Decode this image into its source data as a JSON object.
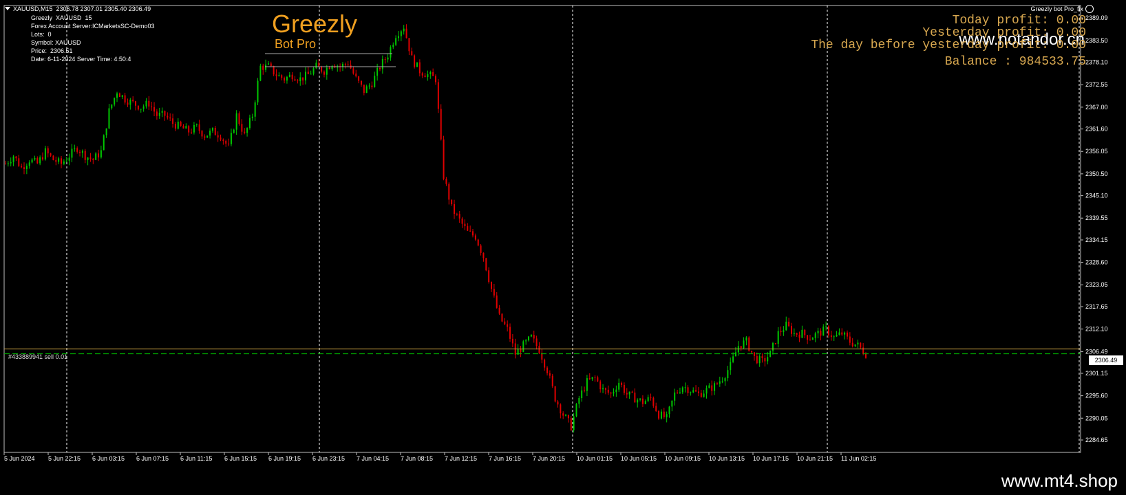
{
  "header": {
    "symbol_line": "XAUUSD,M15  2306.78 2307.01 2305.40 2306.49",
    "info_lines": [
      "Greezly  XAUUSD  15",
      "Forex Account Server:ICMarketsSC-Demo03",
      "Lots:  0",
      "Symbol: XAUUSD",
      "Price:  2306.51",
      "Date: 6-11-2024 Server Time: 4:50:4"
    ],
    "ea_name": "Greezly bot Pro_fix"
  },
  "logo": {
    "title": "Greezly",
    "subtitle": "Bot Pro"
  },
  "profit_panel": {
    "today": "Today profit: 0.00",
    "yesterday": "Yesterday profit: 0.00",
    "day_before": "The day before yesterday profit: 0.00",
    "balance": "Balance : 984533.75"
  },
  "watermarks": {
    "top": "www.notandor.cn",
    "footer": "www.mt4.shop"
  },
  "order": {
    "label": "#433889941 sell 0.01"
  },
  "colors": {
    "bull": "#00c800",
    "bear": "#e00000",
    "grid": "#ffffff",
    "order_line": "#c8a040",
    "price_line": "#00c800"
  },
  "chart_data": {
    "type": "candlestick",
    "symbol": "XAUUSD",
    "timeframe": "M15",
    "current_price": "2306.49",
    "ylim": [
      2284.65,
      2389.09
    ],
    "y_ticks": [
      "2389.09",
      "2383.50",
      "2378.10",
      "2372.55",
      "2367.00",
      "2361.60",
      "2356.05",
      "2350.50",
      "2345.10",
      "2339.55",
      "2334.15",
      "2328.60",
      "2323.05",
      "2317.65",
      "2312.10",
      "2306.49",
      "2301.15",
      "2295.60",
      "2290.05",
      "2284.65"
    ],
    "x_ticks": [
      "5 Jun 2024",
      "5 Jun 22:15",
      "6 Jun 03:15",
      "6 Jun 07:15",
      "6 Jun 11:15",
      "6 Jun 15:15",
      "6 Jun 19:15",
      "6 Jun 23:15",
      "7 Jun 04:15",
      "7 Jun 08:15",
      "7 Jun 12:15",
      "7 Jun 16:15",
      "7 Jun 20:15",
      "10 Jun 01:15",
      "10 Jun 05:15",
      "10 Jun 09:15",
      "10 Jun 13:15",
      "10 Jun 17:15",
      "10 Jun 21:15",
      "11 Jun 02:15"
    ],
    "close_path": [
      2353,
      2355,
      2352,
      2354,
      2353,
      2356,
      2354,
      2353,
      2355,
      2357,
      2355,
      2354,
      2356,
      2366,
      2371,
      2369,
      2368,
      2367,
      2368,
      2365,
      2365,
      2363,
      2362,
      2361,
      2362,
      2360,
      2361,
      2360,
      2357,
      2365,
      2360,
      2365,
      2377,
      2377,
      2375,
      2374,
      2375,
      2374,
      2375,
      2377,
      2376,
      2378,
      2377,
      2378,
      2374,
      2371,
      2373,
      2377,
      2380,
      2385,
      2387,
      2379,
      2376,
      2375,
      2374,
      2350,
      2342,
      2339,
      2336,
      2335,
      2330,
      2322,
      2315,
      2312,
      2306,
      2308,
      2310,
      2307,
      2302,
      2295,
      2291,
      2288,
      2295,
      2299,
      2300,
      2297,
      2296,
      2299,
      2296,
      2295,
      2294,
      2295,
      2291,
      2290,
      2296,
      2298,
      2297,
      2296,
      2297,
      2298,
      2300,
      2303,
      2308,
      2309,
      2305,
      2304,
      2306,
      2311,
      2313,
      2311,
      2311,
      2310,
      2311,
      2312,
      2310,
      2311,
      2309,
      2308,
      2306
    ]
  }
}
